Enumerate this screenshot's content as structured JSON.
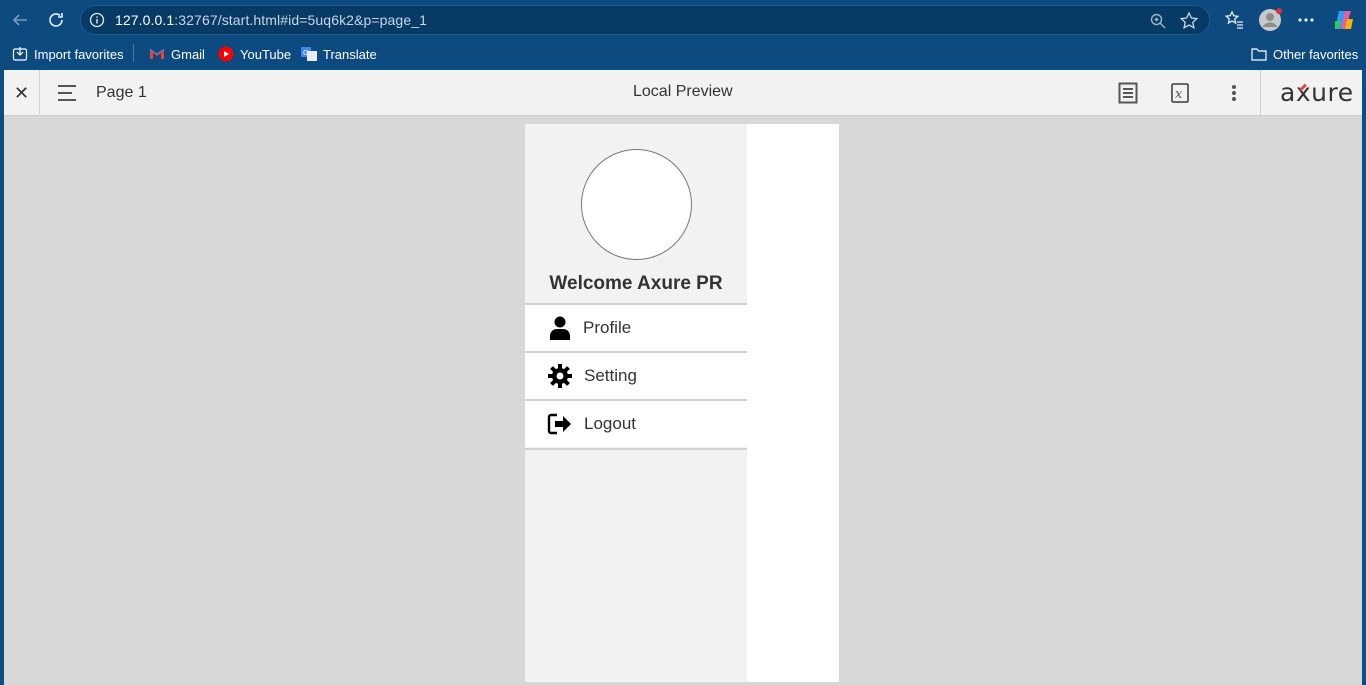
{
  "browser": {
    "url_host": "127.0.0.1",
    "url_rest": ":32767/start.html#id=5uq6k2&p=page_1",
    "bookmarks": [
      {
        "label": "Import favorites",
        "icon": "import-icon"
      },
      {
        "label": "Gmail",
        "icon": "gmail-icon"
      },
      {
        "label": "YouTube",
        "icon": "youtube-icon"
      },
      {
        "label": "Translate",
        "icon": "translate-icon"
      }
    ],
    "other_favorites": "Other favorites"
  },
  "axure": {
    "page_name": "Page 1",
    "title": "Local Preview",
    "logo": "axure"
  },
  "drawer": {
    "welcome": "Welcome Axure PR",
    "items": [
      {
        "label": "Profile",
        "icon": "user-icon"
      },
      {
        "label": "Setting",
        "icon": "gear-icon"
      },
      {
        "label": "Logout",
        "icon": "logout-icon"
      }
    ]
  },
  "colors": {
    "browser_bar": "#0c4a80",
    "canvas_bg": "#d8d8d8",
    "drawer_bg": "#f2f2f2",
    "logo_accent": "#e8463a"
  }
}
